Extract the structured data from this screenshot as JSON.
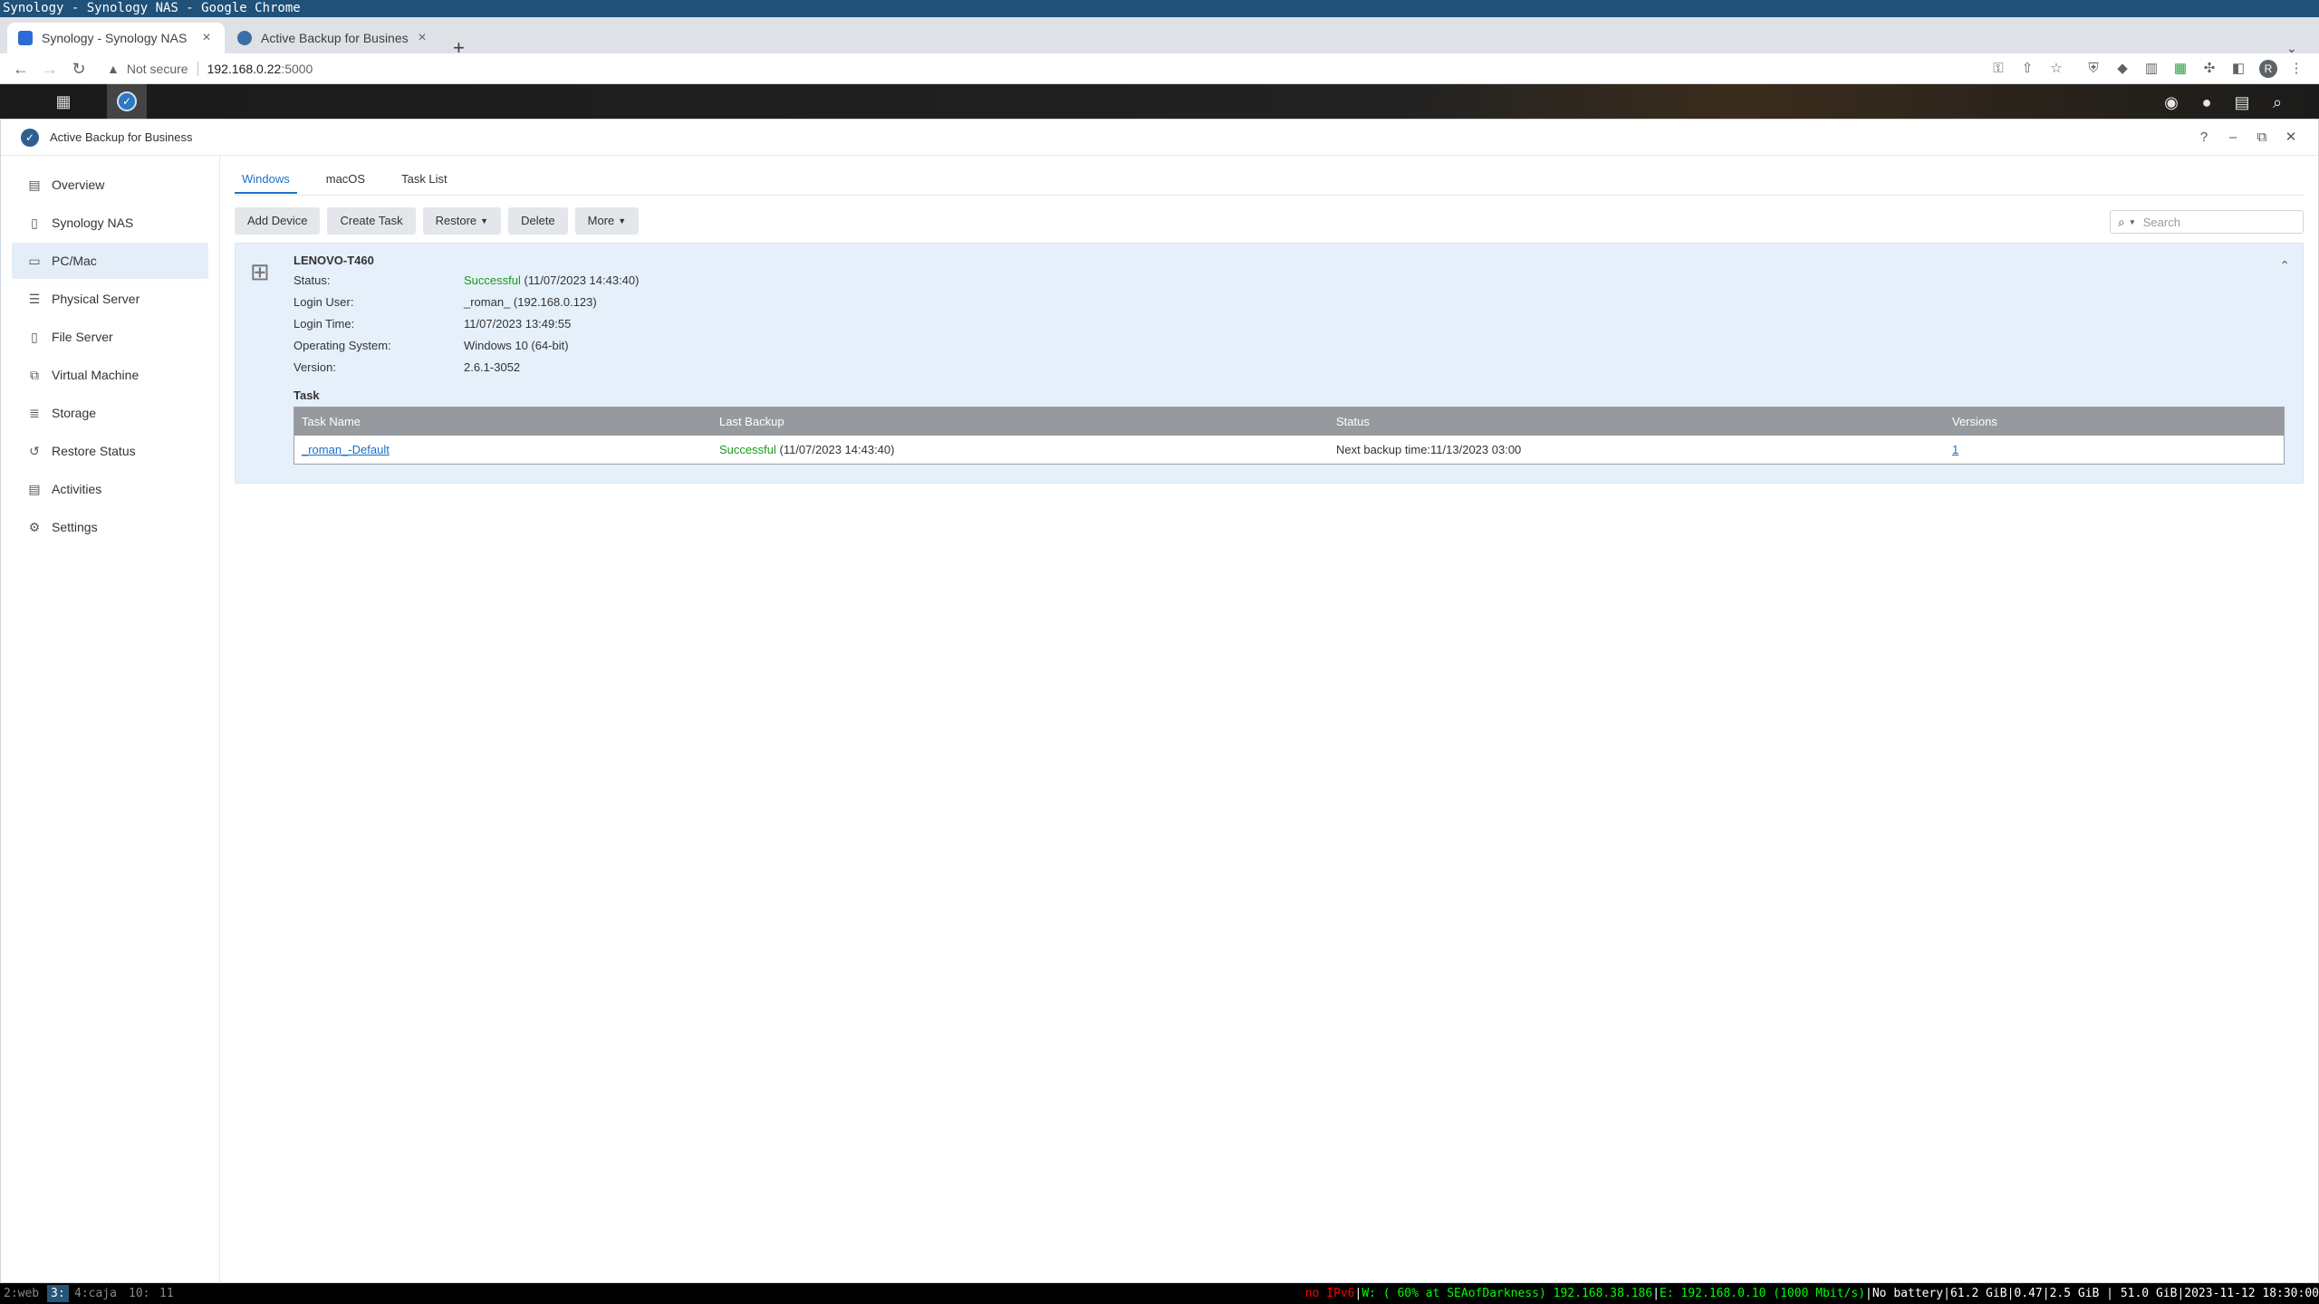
{
  "wm": {
    "title": "Synology - Synology NAS - Google Chrome"
  },
  "browser": {
    "tabs": [
      {
        "title": "Synology - Synology NAS",
        "active": true
      },
      {
        "title": "Active Backup for Business |",
        "active": false
      }
    ],
    "new_tab": "+",
    "omnibox": {
      "security": "Not secure",
      "host": "192.168.0.22",
      "port": ":5000"
    },
    "profile_initial": "R"
  },
  "app": {
    "title": "Active Backup for Business",
    "sidebar": [
      {
        "label": "Overview",
        "icon": "overview-icon",
        "active": false
      },
      {
        "label": "Synology NAS",
        "icon": "nas-icon",
        "active": false
      },
      {
        "label": "PC/Mac",
        "icon": "pc-icon",
        "active": true
      },
      {
        "label": "Physical Server",
        "icon": "server-icon",
        "active": false
      },
      {
        "label": "File Server",
        "icon": "file-server-icon",
        "active": false
      },
      {
        "label": "Virtual Machine",
        "icon": "vm-icon",
        "active": false
      },
      {
        "label": "Storage",
        "icon": "storage-icon",
        "active": false
      },
      {
        "label": "Restore Status",
        "icon": "restore-icon",
        "active": false
      },
      {
        "label": "Activities",
        "icon": "activities-icon",
        "active": false
      },
      {
        "label": "Settings",
        "icon": "gear-icon",
        "active": false
      }
    ],
    "tabs": [
      "Windows",
      "macOS",
      "Task List"
    ],
    "actions": {
      "add_device": "Add Device",
      "create_task": "Create Task",
      "restore": "Restore",
      "delete": "Delete",
      "more": "More"
    },
    "search_placeholder": "Search",
    "device": {
      "name": "LENOVO-T460",
      "status_label": "Status:",
      "status_value": "Successful",
      "status_time": "(11/07/2023 14:43:40)",
      "login_user_label": "Login User:",
      "login_user_value": "_roman_ (192.168.0.123)",
      "login_time_label": "Login Time:",
      "login_time_value": "11/07/2023 13:49:55",
      "os_label": "Operating System:",
      "os_value": "Windows 10 (64-bit)",
      "version_label": "Version:",
      "version_value": "2.6.1-3052",
      "task_heading": "Task",
      "table": {
        "headers": [
          "Task Name",
          "Last Backup",
          "Status",
          "Versions"
        ],
        "rows": [
          {
            "task_name": "_roman_-Default",
            "last_backup_status": "Successful",
            "last_backup_time": "(11/07/2023 14:43:40)",
            "status": "Next backup time:11/13/2023 03:00",
            "versions": "1"
          }
        ]
      }
    }
  },
  "statusbar": {
    "workspaces": [
      "2:web",
      "3:",
      "4:caja",
      "10:",
      "11"
    ],
    "focused_workspace": "3:",
    "ipv6": "no IPv6",
    "wifi": "W: ( 60% at SEAofDarkness) 192.168.38.186",
    "ethernet": "E: 192.168.0.10 (1000 Mbit/s)",
    "battery": "No battery",
    "disk": "61.2 GiB",
    "load": "0.47",
    "memory": "2.5 GiB | 51.0 GiB",
    "datetime": "2023-11-12 18:30:00"
  },
  "colors": {
    "accent": "#1a73c8",
    "success": "#1a9a1a",
    "wm_title_bg": "#1f5179",
    "sidebar_active": "#e4eef9",
    "card_bg": "#e6f0fb"
  }
}
